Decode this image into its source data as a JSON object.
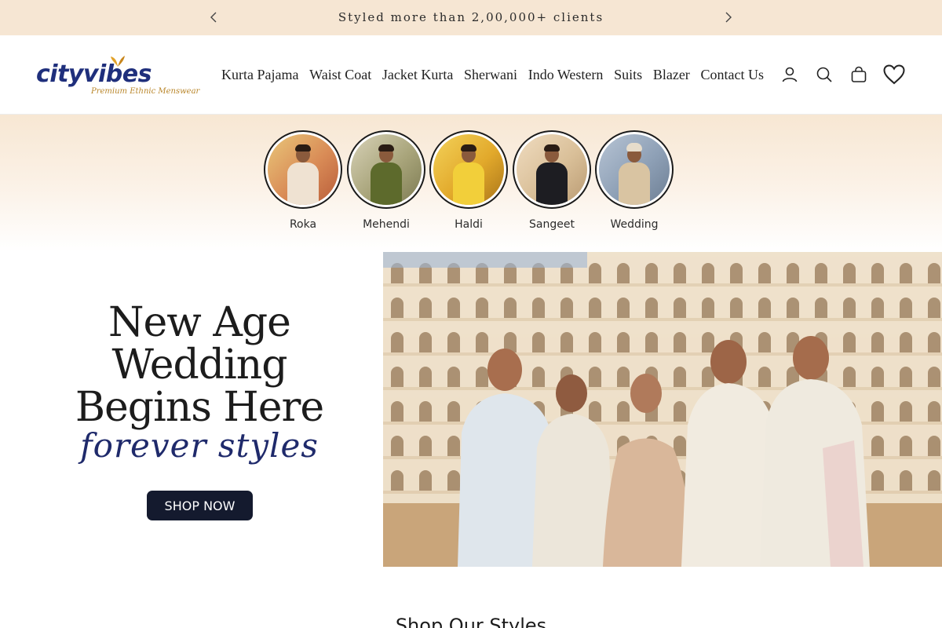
{
  "announcement": {
    "text": "Styled more than 2,00,000+ clients",
    "prev_icon": "chevron-left-icon",
    "next_icon": "chevron-right-icon"
  },
  "header": {
    "logo": {
      "name": "cityvibes",
      "tagline": "Premium Ethnic Menswear"
    },
    "nav": [
      {
        "label": "Kurta Pajama"
      },
      {
        "label": "Waist Coat"
      },
      {
        "label": "Jacket Kurta"
      },
      {
        "label": "Sherwani"
      },
      {
        "label": "Indo Western"
      },
      {
        "label": "Suits"
      },
      {
        "label": "Blazer"
      },
      {
        "label": "Contact Us"
      }
    ],
    "icons": [
      "account-icon",
      "search-icon",
      "cart-bag-icon",
      "wishlist-heart-icon"
    ]
  },
  "occasions": [
    {
      "label": "Roka"
    },
    {
      "label": "Mehendi"
    },
    {
      "label": "Haldi"
    },
    {
      "label": "Sangeet"
    },
    {
      "label": "Wedding"
    }
  ],
  "hero": {
    "line1": "New Age",
    "line2": "Wedding",
    "line3": "Begins Here",
    "script": "forever styles",
    "cta": "SHOP NOW"
  },
  "section": {
    "title": "Shop Our Styles"
  },
  "colors": {
    "announcement_bg": "#f6e6d3",
    "brand_navy": "#1f2f7c",
    "brand_gold": "#b9862a",
    "cta_bg": "#141a2e"
  }
}
